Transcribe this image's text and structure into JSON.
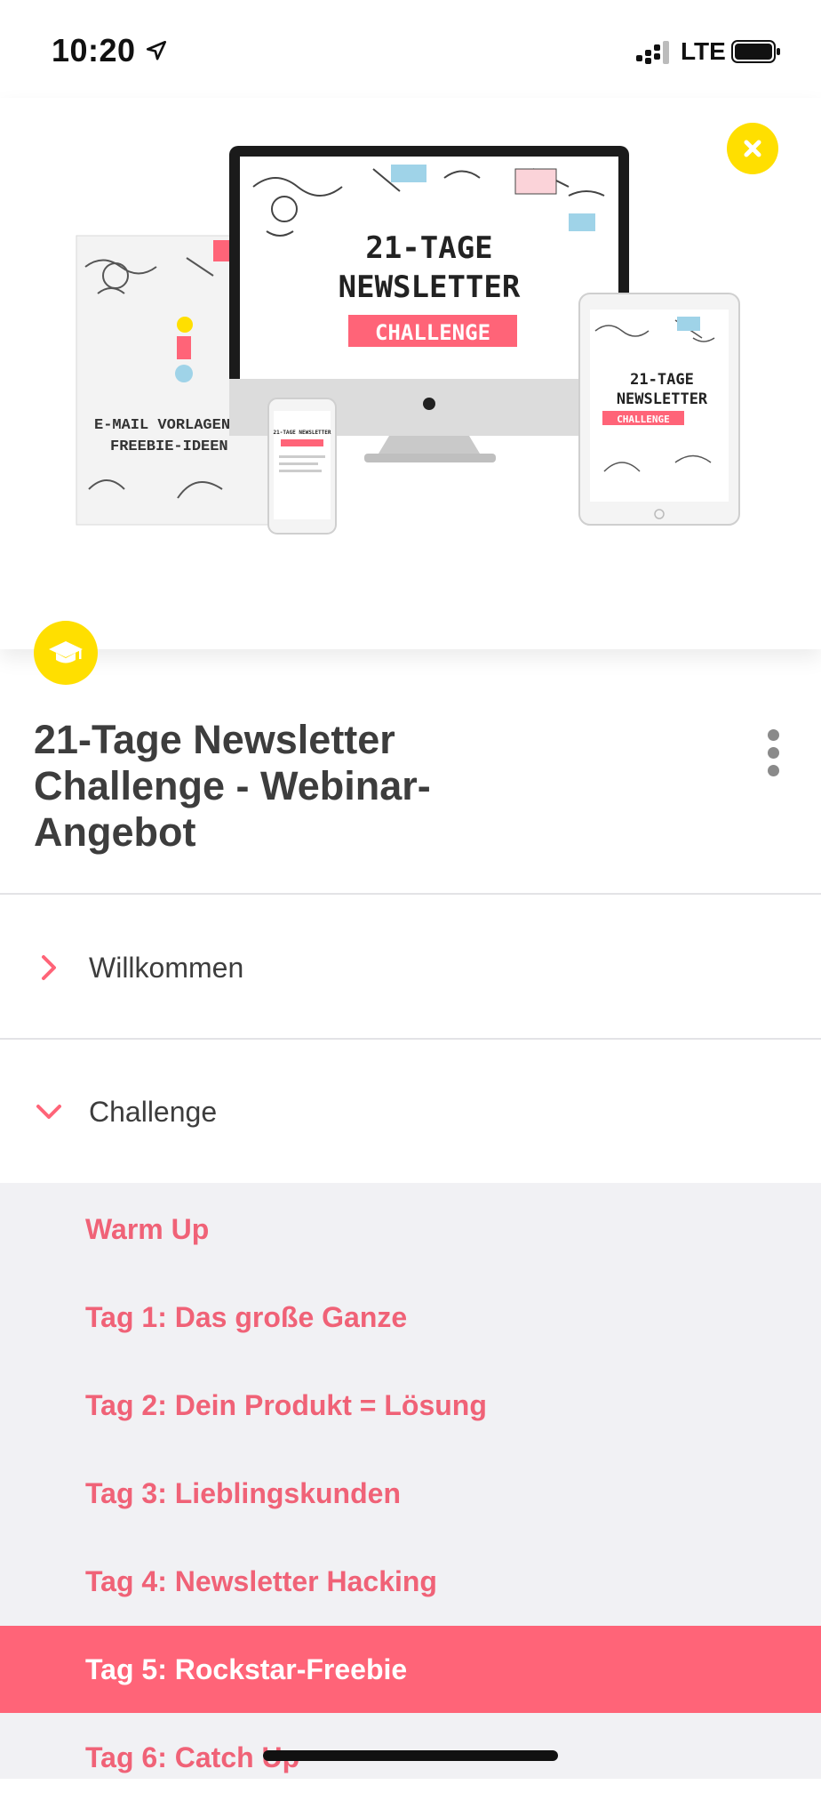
{
  "status_bar": {
    "time": "10:20",
    "network": "LTE"
  },
  "hero": {
    "monitor_title_1": "21-TAGE",
    "monitor_title_2": "NEWSLETTER",
    "monitor_badge": "CHALLENGE",
    "book_line_1": "E-MAIL VORLAGEN",
    "book_line_2": "FREEBIE-IDEEN",
    "tablet_title_1": "21-TAGE",
    "tablet_title_2": "NEWSLETTER",
    "tablet_badge": "CHALLENGE",
    "phone_title": "21-TAGE NEWSLETTER"
  },
  "course": {
    "title": "21-Tage Newsletter Challenge - Webinar-Angebot"
  },
  "sections": [
    {
      "label": "Willkommen",
      "expanded": false
    },
    {
      "label": "Challenge",
      "expanded": true
    }
  ],
  "lessons": [
    {
      "label": "Warm Up"
    },
    {
      "label": "Tag 1: Das große Ganze"
    },
    {
      "label": "Tag 2: Dein Produkt = Lösung"
    },
    {
      "label": "Tag 3: Lieblingskunden"
    },
    {
      "label": "Tag 4: Newsletter Hacking"
    },
    {
      "label": "Tag 5: Rockstar-Freebie"
    },
    {
      "label": "Tag 6: Catch Up"
    }
  ],
  "active_lesson": "Tag 5: Rockstar-Freebie",
  "colors": {
    "accent": "#ff6478",
    "accent_text": "#f06277",
    "badge": "#ffdf00",
    "lesson_bg": "#f1f1f4"
  },
  "icons": {
    "close": "close-icon",
    "course": "graduation-cap-icon",
    "more": "more-vertical-icon",
    "collapsed": "chevron-right-icon",
    "expanded": "chevron-down-icon",
    "location": "location-arrow-icon"
  }
}
